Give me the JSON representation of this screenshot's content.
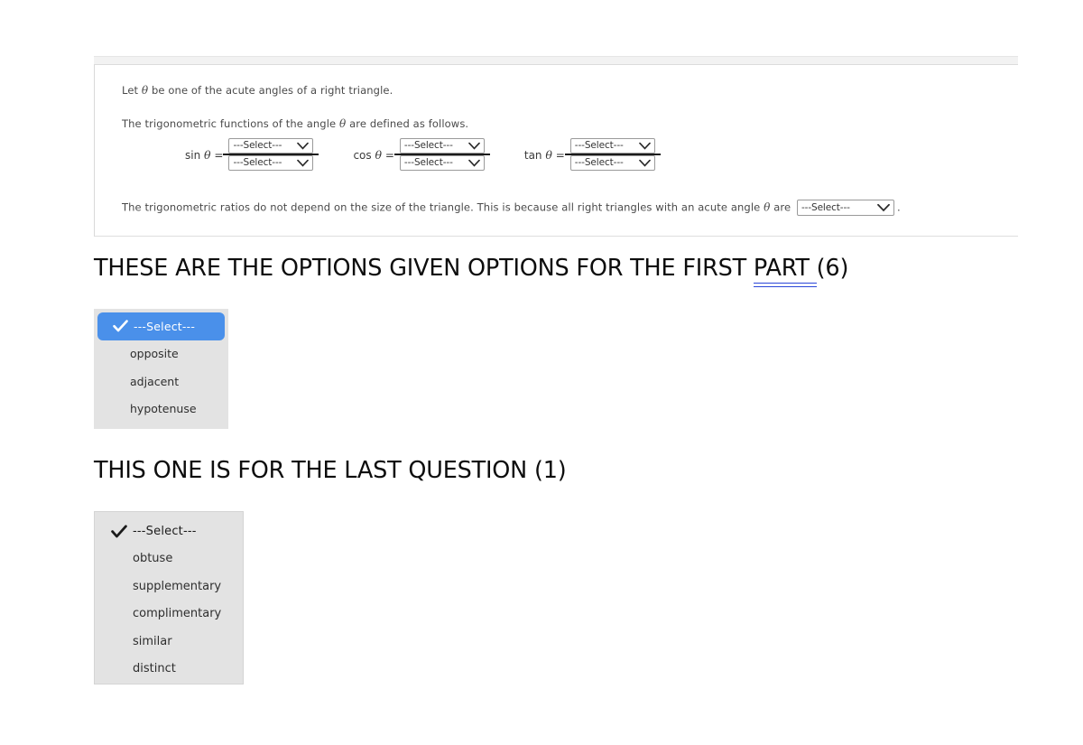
{
  "problem": {
    "line1_pre": "Let ",
    "line1_theta": "θ",
    "line1_post": " be one of the acute angles of a right triangle.",
    "line2_pre": "The trigonometric functions of the angle ",
    "line2_theta": "θ",
    "line2_post": " are defined as follows.",
    "line3_pre": "The trigonometric ratios do not depend on the size of the triangle. This is because all right triangles with an acute angle ",
    "line3_theta": "θ",
    "line3_mid": " are ",
    "line3_end": ".",
    "select_placeholder": "---Select---",
    "chevron_icon": "chevron-down-icon",
    "trig": [
      {
        "name": "sin",
        "label_fn": "sin",
        "label_theta": "θ",
        "label_eq": " = ",
        "numerator": "---Select---",
        "denominator": "---Select---"
      },
      {
        "name": "cos",
        "label_fn": "cos",
        "label_theta": "θ",
        "label_eq": " = ",
        "numerator": "---Select---",
        "denominator": "---Select---"
      },
      {
        "name": "tan",
        "label_fn": "tan",
        "label_theta": "θ",
        "label_eq": " = ",
        "numerator": "---Select---",
        "denominator": "---Select---"
      }
    ],
    "final_select_value": "---Select---"
  },
  "headings": {
    "part": {
      "before_underline": "THESE ARE THE OPTIONS GIVEN OPTIONS FOR THE FIRST ",
      "underlined": "PART ",
      "after_underline": " (6)"
    },
    "last": "THIS ONE IS FOR THE LAST QUESTION  (1)"
  },
  "dropdown_part": {
    "title": "options-for-first-part",
    "selected_index": 0,
    "check_icon": "checkmark-icon",
    "highlight_color": "#4a90ea",
    "background_color": "#e3e3e3",
    "options": [
      {
        "label": "---Select---",
        "selected": true
      },
      {
        "label": "opposite",
        "selected": false
      },
      {
        "label": "adjacent",
        "selected": false
      },
      {
        "label": "hypotenuse",
        "selected": false
      }
    ]
  },
  "dropdown_last": {
    "title": "options-for-last-question",
    "selected_index": 0,
    "check_icon": "checkmark-icon",
    "background_color": "#e3e3e3",
    "options": [
      {
        "label": "---Select---",
        "selected": true
      },
      {
        "label": "obtuse",
        "selected": false
      },
      {
        "label": "supplementary",
        "selected": false
      },
      {
        "label": "complimentary",
        "selected": false
      },
      {
        "label": "similar",
        "selected": false
      },
      {
        "label": "distinct",
        "selected": false
      }
    ]
  }
}
